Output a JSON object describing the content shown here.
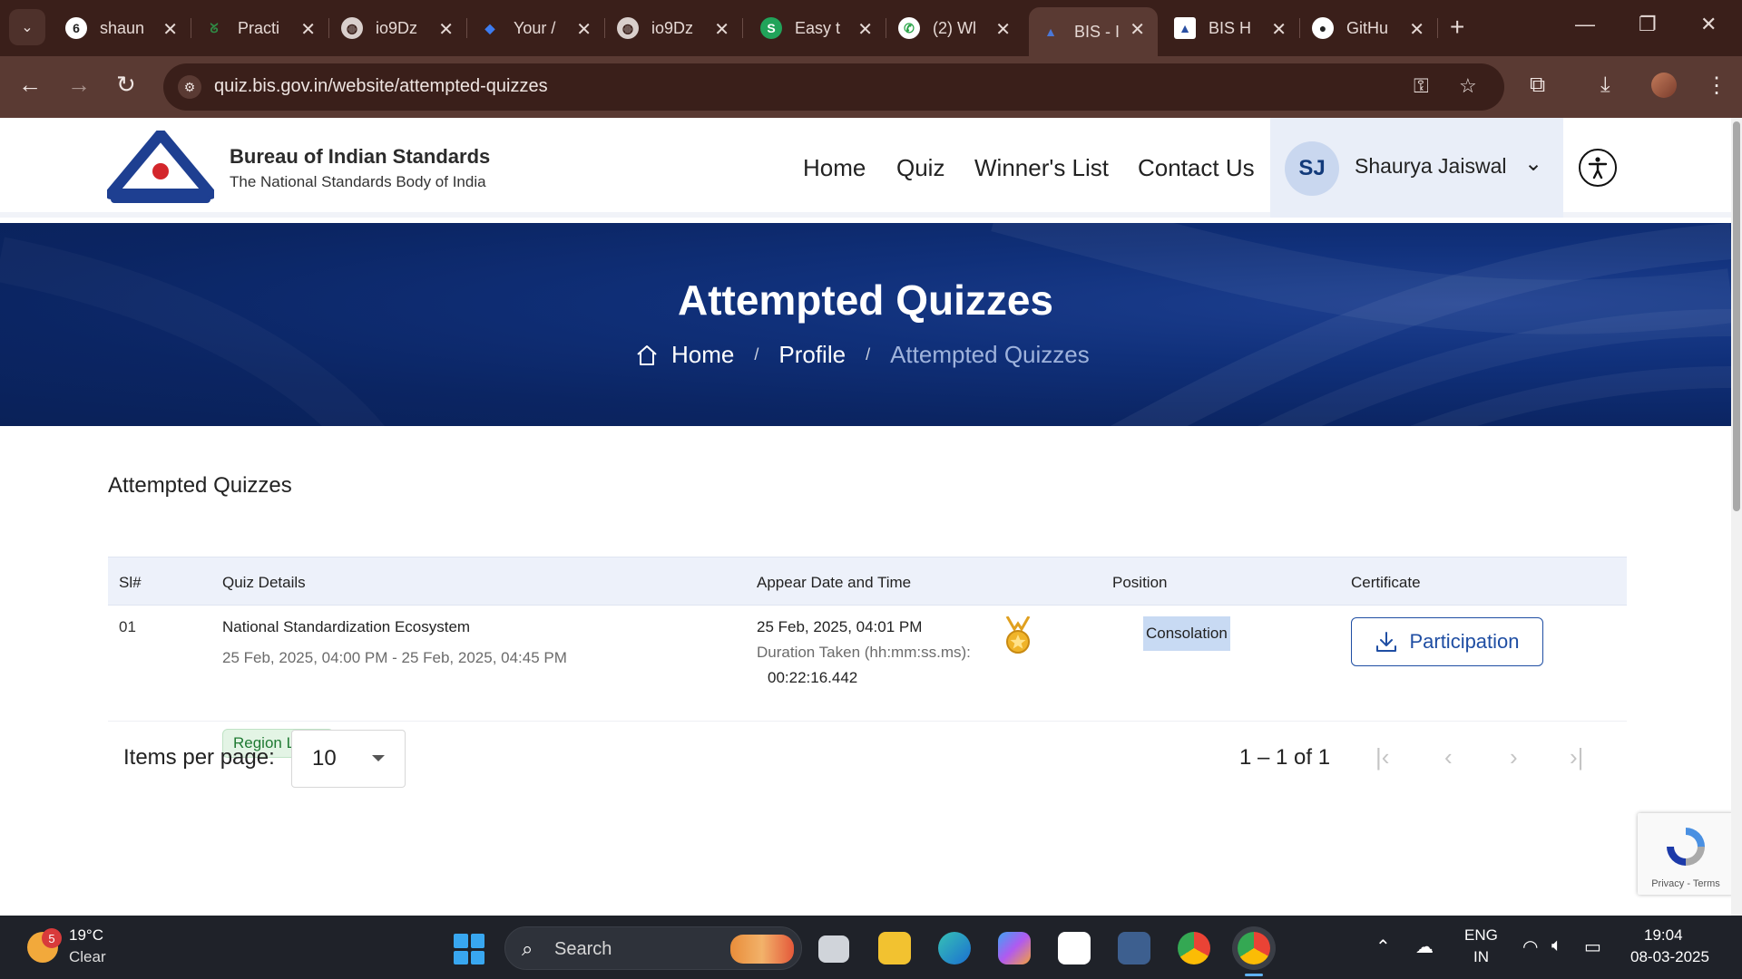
{
  "browser": {
    "tabs": [
      {
        "title": "shaun",
        "icon": "six-icon"
      },
      {
        "title": "Practi",
        "icon": "gfg-icon"
      },
      {
        "title": "io9Dz",
        "icon": "globe-icon"
      },
      {
        "title": "Your /",
        "icon": "gem-icon"
      },
      {
        "title": "io9Dz",
        "icon": "globe-icon"
      },
      {
        "title": "Easy t",
        "icon": "s-icon"
      },
      {
        "title": "(2) Wl",
        "icon": "whatsapp-icon"
      },
      {
        "title": "BIS - I",
        "icon": "bis-icon"
      },
      {
        "title": "BIS H",
        "icon": "bis-icon"
      },
      {
        "title": "GitHu",
        "icon": "github-icon"
      }
    ],
    "url": "quiz.bis.gov.in/website/attempted-quizzes"
  },
  "site": {
    "brand_title": "Bureau of Indian Standards",
    "brand_subtitle": "The National Standards Body of India",
    "nav": [
      "Home",
      "Quiz",
      "Winner's List",
      "Contact Us"
    ],
    "user_initials": "SJ",
    "user_name": "Shaurya Jaiswal"
  },
  "banner": {
    "title": "Attempted Quizzes",
    "breadcrumb": [
      "Home",
      "Profile",
      "Attempted Quizzes"
    ]
  },
  "section": {
    "title": "Attempted Quizzes"
  },
  "table": {
    "headers": [
      "Sl#",
      "Quiz Details",
      "Appear Date and Time",
      "Position",
      "Certificate"
    ],
    "rows": [
      {
        "sl": "01",
        "quiz_name": "National Standardization Ecosystem",
        "quiz_window": "25 Feb, 2025, 04:00 PM - 25 Feb, 2025, 04:45 PM",
        "level": "Region Level",
        "appear_datetime": "25 Feb, 2025, 04:01 PM",
        "duration_label": "Duration Taken (hh:mm:ss.ms):",
        "duration": "00:22:16.442",
        "position": "Consolation",
        "certificate": "Participation"
      }
    ]
  },
  "pagination": {
    "items_per_page_label": "Items per page:",
    "items_per_page": "10",
    "range": "1 – 1 of 1"
  },
  "recaptcha": {
    "text": "Privacy - Terms"
  },
  "taskbar": {
    "weather_badge": "5",
    "temperature": "19°C",
    "condition": "Clear",
    "search_label": "Search",
    "lang_line1": "ENG",
    "lang_line2": "IN",
    "time": "19:04",
    "date": "08-03-2025"
  },
  "colors": {
    "chrome_dark": "#3a1f1a",
    "chrome_toolbar": "#5a3a33",
    "banner_blue": "#0b2563",
    "accent_blue": "#1f4ea3",
    "header_row": "#edf1fa"
  }
}
